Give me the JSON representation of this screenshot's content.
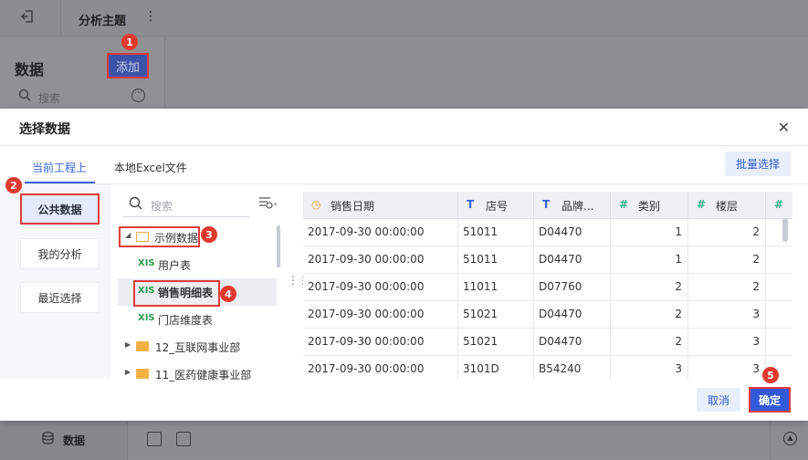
{
  "topbar": {
    "back_icon": "exit-icon",
    "title": "分析主题",
    "more_icon": "vertical-dots-icon"
  },
  "left_panel": {
    "title": "数据",
    "add_label": "添加",
    "search_placeholder": "搜索"
  },
  "bottom_bar": {
    "data_tab_label": "数据"
  },
  "badges": [
    "1",
    "2",
    "3",
    "4",
    "5"
  ],
  "dialog": {
    "title": "选择数据",
    "close_icon": "close-icon",
    "tabs": [
      {
        "label": "当前工程上",
        "active": true
      },
      {
        "label": "本地Excel文件",
        "active": false
      }
    ],
    "batch_select_label": "批量选择",
    "sidebar": [
      {
        "label": "公共数据",
        "active": true
      },
      {
        "label": "我的分析",
        "active": false
      },
      {
        "label": "最近选择",
        "active": false
      }
    ],
    "tree": {
      "search_placeholder": "搜索",
      "nodes": [
        {
          "label": "示例数据",
          "type": "folder-open"
        },
        {
          "label": "用户表",
          "type": "table",
          "icon_text": "XIS"
        },
        {
          "label": "销售明细表",
          "type": "table",
          "icon_text": "XIS",
          "selected": true
        },
        {
          "label": "门店维度表",
          "type": "table",
          "icon_text": "XIS"
        },
        {
          "label": "12_互联网事业部",
          "type": "folder"
        },
        {
          "label": "11_医药健康事业部",
          "type": "folder"
        }
      ]
    },
    "table": {
      "columns": [
        {
          "label": "销售日期",
          "type_icon": "◷"
        },
        {
          "label": "店号",
          "type_icon": "T"
        },
        {
          "label": "品牌...",
          "type_icon": "T"
        },
        {
          "label": "类别",
          "type_icon": "#"
        },
        {
          "label": "楼层",
          "type_icon": "#"
        },
        {
          "label": "",
          "type_icon": "#"
        }
      ],
      "rows": [
        [
          "2017-09-30 00:00:00",
          "51011",
          "D04470",
          "1",
          "2"
        ],
        [
          "2017-09-30 00:00:00",
          "51011",
          "D04470",
          "1",
          "2"
        ],
        [
          "2017-09-30 00:00:00",
          "11011",
          "D07760",
          "2",
          "2"
        ],
        [
          "2017-09-30 00:00:00",
          "51021",
          "D04470",
          "2",
          "3"
        ],
        [
          "2017-09-30 00:00:00",
          "51021",
          "D04470",
          "2",
          "3"
        ],
        [
          "2017-09-30 00:00:00",
          "3101D",
          "B54240",
          "3",
          "3"
        ]
      ]
    },
    "cancel_label": "取消",
    "ok_label": "确定"
  },
  "colors": {
    "accent": "#3159d8",
    "highlight": "#e03b3b"
  }
}
